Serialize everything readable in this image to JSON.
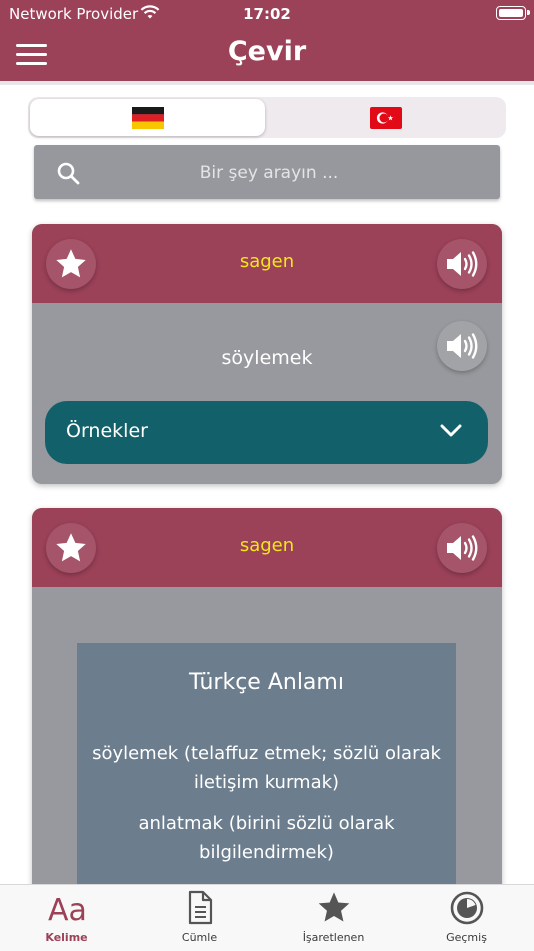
{
  "status_bar": {
    "carrier": "Network Provider",
    "time": "17:02"
  },
  "nav": {
    "title": "Çevir",
    "menu_icon": "hamburger-menu-icon"
  },
  "language_toggle": {
    "source": {
      "flag": "germany-flag-icon",
      "selected": true
    },
    "target": {
      "flag": "turkey-flag-icon",
      "selected": false
    }
  },
  "search": {
    "placeholder": "Bir şey arayın ..."
  },
  "cards": [
    {
      "word": "sagen",
      "translation": "söylemek",
      "examples_label": "Örnekler"
    },
    {
      "word": "sagen",
      "meaning_title": "Türkçe Anlamı",
      "meanings": [
        "söylemek (telaffuz etmek; sözlü olarak iletişim kurmak)",
        "anlatmak (birini sözlü olarak bilgilendirmek)"
      ]
    }
  ],
  "tabs": [
    {
      "label": "Kelime",
      "icon": "text-size-icon",
      "active": true
    },
    {
      "label": "Cümle",
      "icon": "document-icon",
      "active": false
    },
    {
      "label": "İşaretlenen",
      "icon": "star-icon",
      "active": false
    },
    {
      "label": "Geçmiş",
      "icon": "history-clock-icon",
      "active": false
    }
  ],
  "colors": {
    "brand": "#9b4158",
    "word_highlight": "#f3e61b",
    "examples_button": "#12616a",
    "card_body": "#97999e",
    "meaning_box": "#6c7d8e"
  }
}
